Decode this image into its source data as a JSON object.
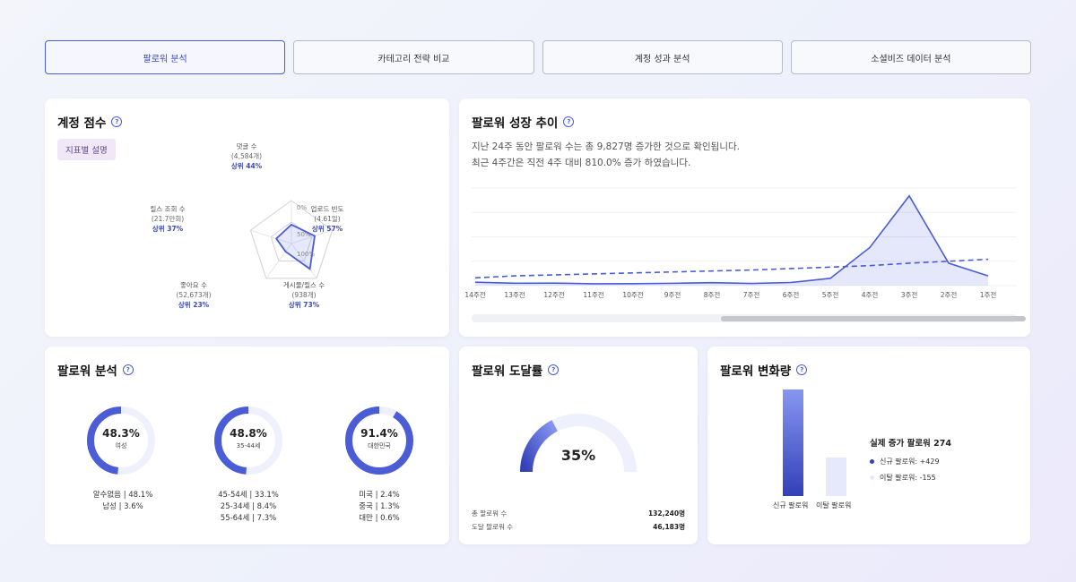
{
  "tabs": [
    {
      "label": "팔로워 분석",
      "active": true
    },
    {
      "label": "카테고리 전략 비교",
      "active": false
    },
    {
      "label": "계정 성과 분석",
      "active": false
    },
    {
      "label": "소셜비즈 데이터 분석",
      "active": false
    }
  ],
  "account_score": {
    "title": "계정 점수",
    "badge": "지표별 설명",
    "radar_ticks": [
      "0%",
      "50%",
      "100%"
    ],
    "metrics": [
      {
        "name": "댓글 수",
        "count": "(4,584개)",
        "rank": "상위 44%",
        "percentile": 44
      },
      {
        "name": "업로드 빈도",
        "count": "(4.61일)",
        "rank": "상위 57%",
        "percentile": 57
      },
      {
        "name": "게시물/릴스 수",
        "count": "(938개)",
        "rank": "상위 73%",
        "percentile": 73
      },
      {
        "name": "좋아요 수",
        "count": "(52,673개)",
        "rank": "상위 23%",
        "percentile": 23
      },
      {
        "name": "릴스 조회 수",
        "count": "(21.7만회)",
        "rank": "상위 37%",
        "percentile": 37
      }
    ]
  },
  "growth": {
    "title": "팔로워 성장 추이",
    "desc1": "지난 24주 동안 팔로워 수는 총 9,827명 증가한 것으로 확인됩니다.",
    "desc2": "최근 4주간은 직전 4주 대비 810.0% 증가 하였습니다."
  },
  "chart_data": {
    "type": "area",
    "categories": [
      "14주전",
      "13주전",
      "12주전",
      "11주전",
      "10주전",
      "9주전",
      "8주전",
      "7주전",
      "6주전",
      "5주전",
      "4주전",
      "3주전",
      "2주전",
      "1주전"
    ],
    "series": [
      {
        "values": [
          3.5,
          2.5,
          2.6,
          1.9,
          2.0,
          2.4,
          3.0,
          2.2,
          3.2,
          7.5,
          39,
          92,
          23,
          10
        ]
      },
      {
        "values": [
          8,
          10,
          11,
          12,
          13,
          14,
          15,
          16,
          17.5,
          19,
          20.5,
          23,
          25,
          27
        ]
      }
    ],
    "ylim": [
      0,
      100
    ],
    "grid": true
  },
  "follower_analysis": {
    "title": "팔로워 분석",
    "donuts": [
      {
        "value": "48.3%",
        "label": "여성",
        "pct": 48.3,
        "list": [
          "알수없음 | 48.1%",
          "남성 | 3.6%"
        ]
      },
      {
        "value": "48.8%",
        "label": "35-44세",
        "pct": 48.8,
        "list": [
          "45-54세 | 33.1%",
          "25-34세 | 8.4%",
          "55-64세 | 7.3%"
        ]
      },
      {
        "value": "91.4%",
        "label": "대한민국",
        "pct": 91.4,
        "list": [
          "미국 | 2.4%",
          "중국 | 1.3%",
          "대만 | 0.6%"
        ]
      }
    ]
  },
  "reach": {
    "title": "팔로워 도달률",
    "value": "35%",
    "pct": 35,
    "total_label": "총 팔로워 수",
    "total_value": "132,240명",
    "reach_label": "도달 팔로워 수",
    "reach_value": "46,183명"
  },
  "change": {
    "title": "팔로워 변화량",
    "summary": "실제 증가 팔로워 274",
    "new_legend": "신규 팔로워: +429",
    "lost_legend": "이탈 팔로워: -155",
    "new_label": "신규 팔로워",
    "lost_label": "이탈 팔로워",
    "new_value": 429,
    "lost_value": 155,
    "colors": {
      "new": "#3340b8",
      "lost": "#e6e9fb"
    }
  }
}
